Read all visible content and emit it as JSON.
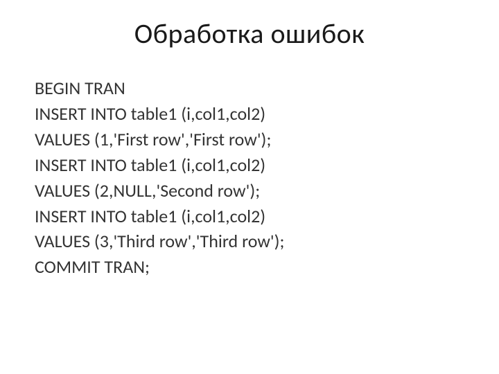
{
  "title": "Обработка ошибок",
  "code": {
    "lines": [
      "BEGIN TRAN",
      "INSERT INTO table1 (i,col1,col2)",
      "VALUES (1,'First row','First row');",
      "INSERT INTO table1 (i,col1,col2)",
      "VALUES (2,NULL,'Second row');",
      "INSERT INTO table1 (i,col1,col2)",
      "VALUES (3,'Third row','Third row');",
      "COMMIT TRAN;"
    ]
  }
}
